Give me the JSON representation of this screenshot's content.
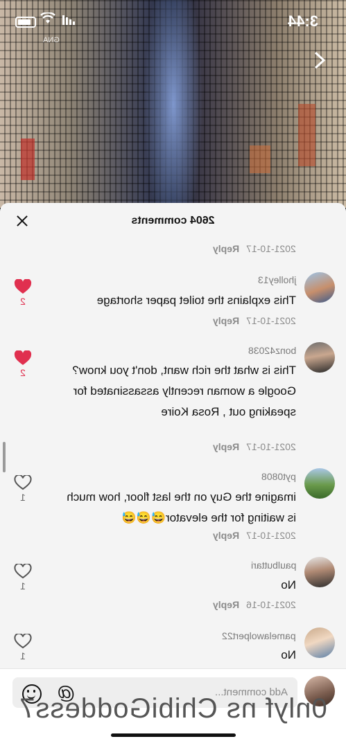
{
  "status_bar": {
    "time": "3:44"
  },
  "video": {
    "overlay_text": "GNA"
  },
  "comments_sheet": {
    "title": "2604 comments",
    "partial_top": {
      "date": "2021-10-17",
      "reply_label": "Reply"
    },
    "comments": [
      {
        "username": "jholley13",
        "text": "This explains the toilet paper shortage",
        "date": "2021-10-17",
        "reply_label": "Reply",
        "likes": "2",
        "liked": true
      },
      {
        "username": "bonz42038",
        "text": "This is what the rich want, don't you know? Google a woman recently assassinated for speaking out , Rosa Koire",
        "date": "2021-10-17",
        "reply_label": "Reply",
        "likes": "2",
        "liked": true
      },
      {
        "username": "pyt0808",
        "text": "imagine the Guy on the last floor, how much is waiting for the elevator😅😅😅",
        "date": "2021-10-17",
        "reply_label": "Reply",
        "likes": "1",
        "liked": false
      },
      {
        "username": "paulbuttari",
        "text": "No",
        "date": "2021-10-16",
        "reply_label": "Reply",
        "likes": "1",
        "liked": false
      },
      {
        "username": "pamelawolpert22",
        "text": "No",
        "likes": "1",
        "liked": false
      }
    ]
  },
  "comment_input": {
    "placeholder": "Add comment..."
  },
  "watermark": "0nlyf ns ChibiGoddess7",
  "colors": {
    "like_red": "#e0304f",
    "sheet_bg": "#f4f4f4"
  }
}
